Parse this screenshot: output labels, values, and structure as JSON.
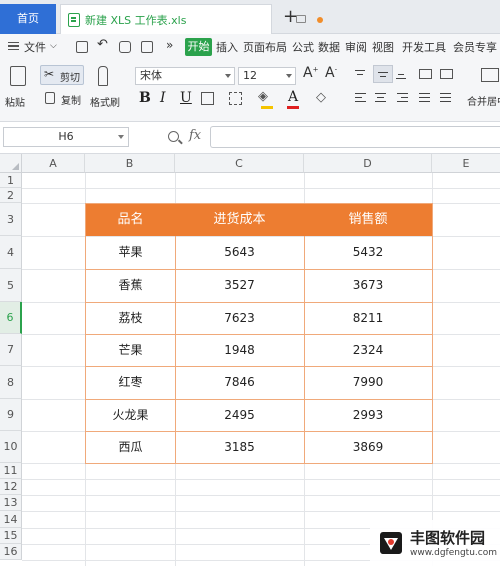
{
  "tabs": {
    "home": "首页",
    "file": "新建 XLS 工作表.xls",
    "new_tab": "+"
  },
  "menu": {
    "file": "文件",
    "items": [
      "开始",
      "插入",
      "页面布局",
      "公式",
      "数据",
      "审阅",
      "视图",
      "开发工具",
      "会员专享"
    ],
    "more": "»"
  },
  "ribbon": {
    "paste": "粘贴",
    "cut": "剪切",
    "copy": "复制",
    "format_painter": "格式刷",
    "font_name": "宋体",
    "font_size": "12",
    "merge_center": "合并居中",
    "bold": "B",
    "italic": "I",
    "underline": "U"
  },
  "formula_bar": {
    "cell_ref": "H6",
    "fx": "fx",
    "value": ""
  },
  "columns": [
    "A",
    "B",
    "C",
    "D",
    "E"
  ],
  "rows": [
    "1",
    "2",
    "3",
    "4",
    "5",
    "6",
    "7",
    "8",
    "9",
    "10",
    "11",
    "12",
    "13",
    "14",
    "15",
    "16"
  ],
  "active_row": "6",
  "table": {
    "headers": [
      "品名",
      "进货成本",
      "销售额"
    ],
    "rows": [
      [
        "苹果",
        "5643",
        "5432"
      ],
      [
        "香蕉",
        "3527",
        "3673"
      ],
      [
        "荔枝",
        "7623",
        "8211"
      ],
      [
        "芒果",
        "1948",
        "2324"
      ],
      [
        "红枣",
        "7846",
        "7990"
      ],
      [
        "火龙果",
        "2495",
        "2993"
      ],
      [
        "西瓜",
        "3185",
        "3869"
      ]
    ]
  },
  "colors": {
    "header_fill": "#ed7d31",
    "accent_green": "#2ba24c",
    "home_tab": "#2f6fd6"
  },
  "watermark": {
    "title": "丰图软件园",
    "url": "www.dgfengtu.com"
  }
}
